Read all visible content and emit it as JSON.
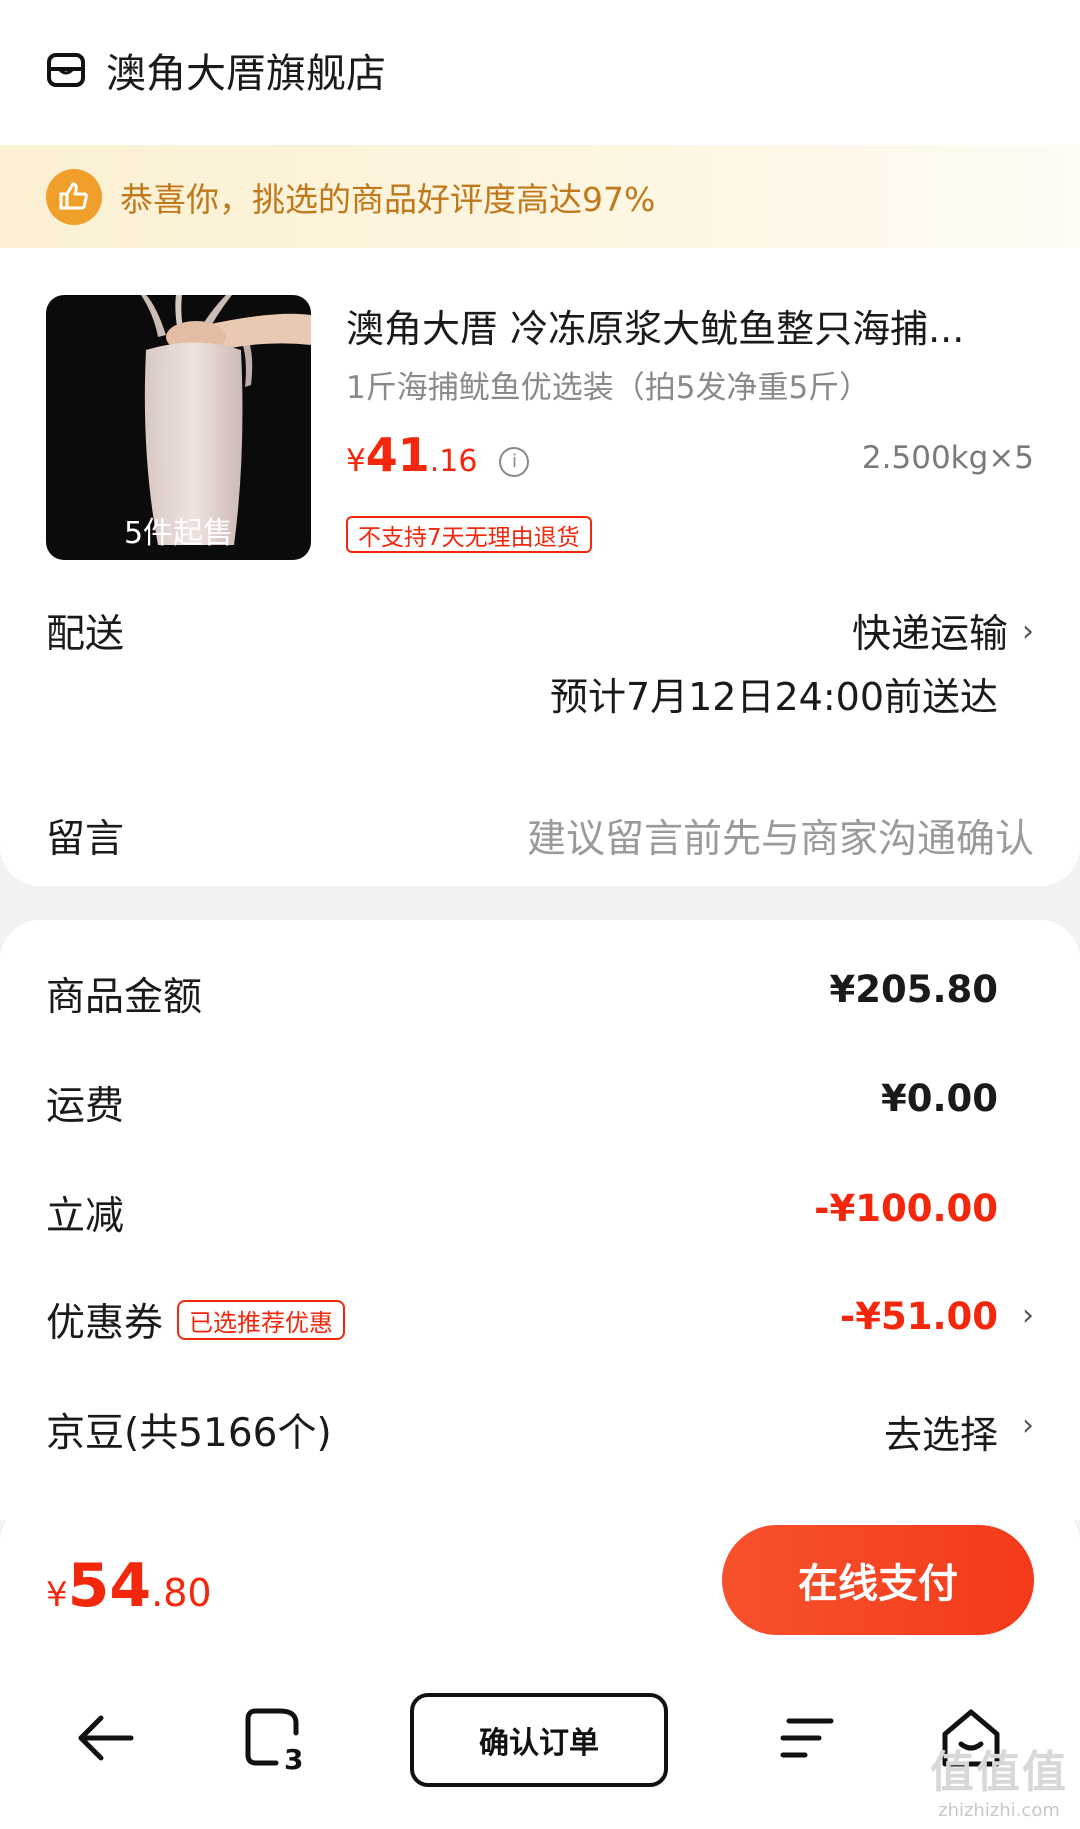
{
  "shop": {
    "name": "澳角大厝旗舰店",
    "icon": "store-icon"
  },
  "banner": {
    "text": "恭喜你，挑选的商品好评度高达97%",
    "icon": "thumbs-up-icon"
  },
  "product": {
    "badge": "5件起售",
    "title": "澳角大厝 冷冻原浆大鱿鱼整只海捕...",
    "spec": "1斤海捕鱿鱼优选装（拍5发净重5斤）",
    "price_currency": "¥",
    "price_int": "41",
    "price_dec": ".16",
    "quantity": "2.500kg×5",
    "return_tag": "不支持7天无理由退货"
  },
  "delivery": {
    "label": "配送",
    "method": "快递运输",
    "eta": "预计7月12日24:00前送达"
  },
  "note": {
    "label": "留言",
    "placeholder": "建议留言前先与商家沟通确认"
  },
  "summary": {
    "goods_label": "商品金额",
    "goods_value": "¥205.80",
    "shipping_label": "运费",
    "shipping_value": "¥0.00",
    "discount_label": "立减",
    "discount_value": "-¥100.00",
    "coupon_label": "优惠券",
    "coupon_tag": "已选推荐优惠",
    "coupon_value": "-¥51.00",
    "beans_label": "京豆(共5166个)",
    "beans_action": "去选择"
  },
  "pay": {
    "currency": "¥",
    "total_int": "54",
    "total_dec": ".80",
    "button": "在线支付"
  },
  "nav": {
    "confirm": "确认订单",
    "tabs_count": "3"
  },
  "watermark": {
    "logo": "值值值",
    "url": "zhizhizhi.com"
  },
  "colors": {
    "accent": "#f2270c",
    "banner_text": "#c0781a",
    "banner_icon": "#f0a02a"
  }
}
